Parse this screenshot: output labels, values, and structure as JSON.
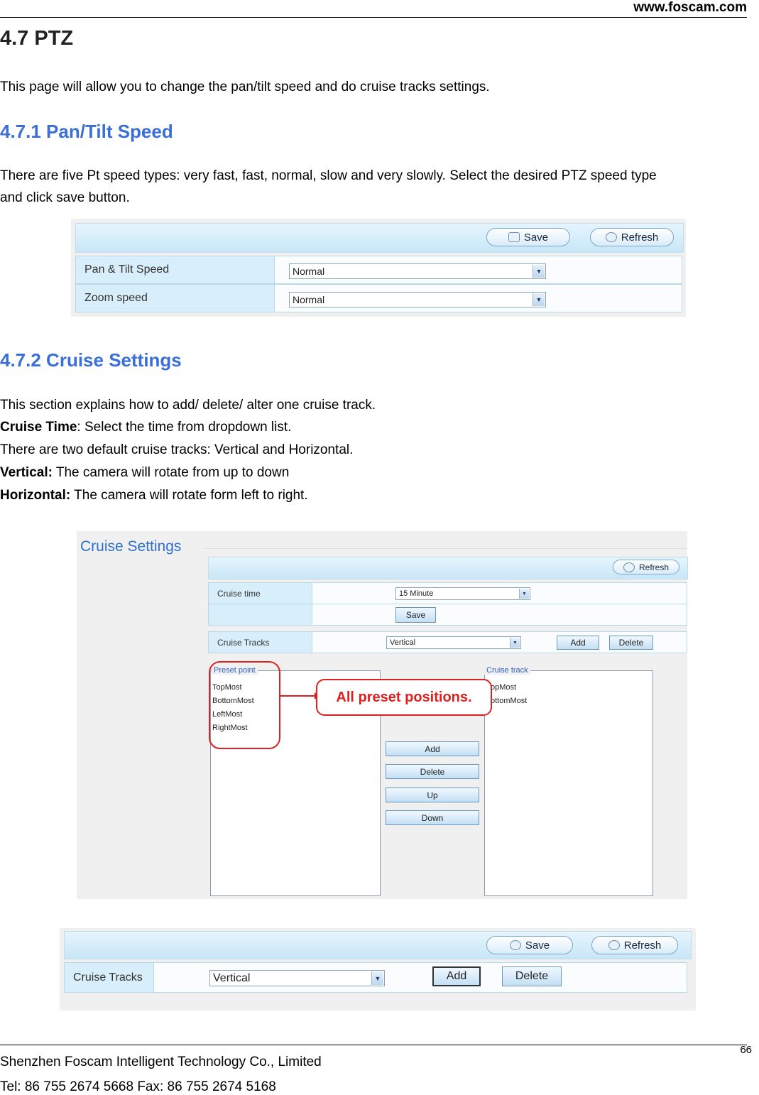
{
  "header": {
    "site": "www.foscam.com"
  },
  "section": {
    "title": "4.7 PTZ",
    "intro": "This page will allow you to change the pan/tilt speed and do cruise tracks settings."
  },
  "speed": {
    "heading": "4.7.1 Pan/Tilt Speed",
    "line1": "There are five Pt speed types: very fast, fast, normal, slow and very slowly. Select the desired PTZ speed type",
    "line2": "and click save button.",
    "ui": {
      "save": "Save",
      "refresh": "Refresh",
      "rows": [
        {
          "label": "Pan & Tilt Speed",
          "value": "Normal"
        },
        {
          "label": "Zoom speed",
          "value": "Normal"
        }
      ]
    }
  },
  "cruise": {
    "heading": "4.7.2 Cruise Settings",
    "lines": {
      "l1": "This section explains how to add/ delete/ alter one cruise track.",
      "l2_bold": "Cruise Time",
      "l2_rest": ": Select the time from dropdown list.",
      "l3": "There are two default cruise tracks: Vertical and Horizontal.",
      "l4_bold": "Vertical:",
      "l4_rest": " The camera will rotate from up to down",
      "l5_bold": "Horizontal:",
      "l5_rest": " The camera will rotate form left to right."
    },
    "ui": {
      "title": "Cruise Settings",
      "refresh": "Refresh",
      "cruise_time_label": "Cruise time",
      "cruise_time_value": "15 Minute",
      "save": "Save",
      "cruise_tracks_label": "Cruise Tracks",
      "cruise_tracks_value": "Vertical",
      "add": "Add",
      "delete": "Delete",
      "preset_legend": "Preset point",
      "preset_items": [
        "TopMost",
        "BottomMost",
        "LeftMost",
        "RightMost"
      ],
      "track_legend": "Cruise track",
      "track_items": [
        "opMost",
        "ottomMost"
      ],
      "mid_buttons": [
        "Add",
        "Delete",
        "Up",
        "Down"
      ],
      "callout": "All preset positions."
    },
    "ui2": {
      "save": "Save",
      "refresh": "Refresh",
      "label": "Cruise Tracks",
      "value": "Vertical",
      "add": "Add",
      "delete": "Delete"
    }
  },
  "footer": {
    "page": "66",
    "company": "Shenzhen Foscam Intelligent Technology Co., Limited",
    "contact": "Tel: 86 755 2674 5668 Fax: 86 755 2674 5168"
  }
}
